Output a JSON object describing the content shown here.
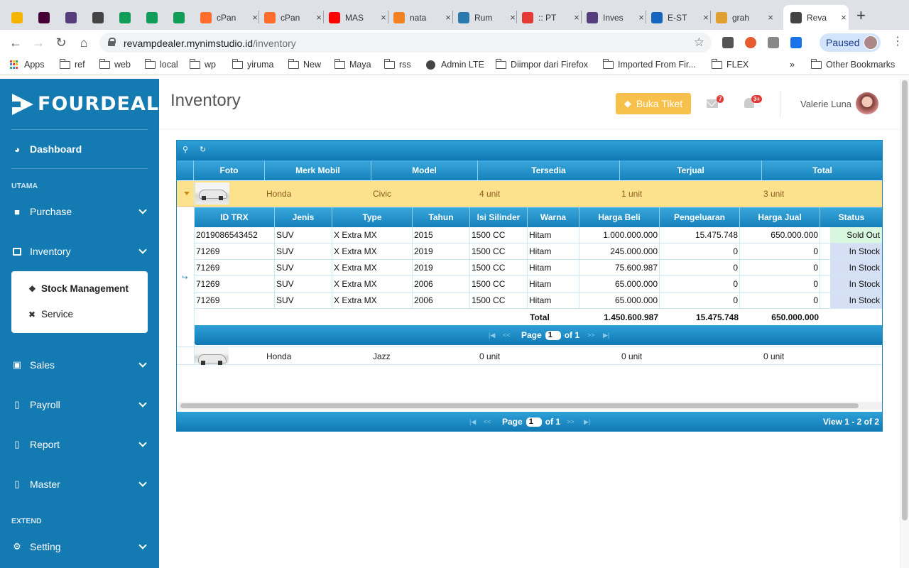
{
  "browser": {
    "tabs": [
      {
        "title": "",
        "favicon": "google-drive-icon",
        "color": "#f4b400"
      },
      {
        "title": "",
        "favicon": "adobe-xd-icon",
        "color": "#470137"
      },
      {
        "title": "",
        "favicon": "bootstrap-icon",
        "color": "#563d7c"
      },
      {
        "title": "",
        "favicon": "globe-icon",
        "color": "#444444"
      },
      {
        "title": "",
        "favicon": "google-sheets-icon",
        "color": "#0f9d58"
      },
      {
        "title": "",
        "favicon": "dollar-icon",
        "color": "#0f9d58"
      },
      {
        "title": "",
        "favicon": "google-sheets-icon",
        "color": "#0f9d58"
      },
      {
        "title": "cPan",
        "favicon": "cpanel-icon",
        "color": "#ff6c2c"
      },
      {
        "title": "cPan",
        "favicon": "cpanel-icon",
        "color": "#ff6c2c"
      },
      {
        "title": "MAS",
        "favicon": "youtube-icon",
        "color": "#ff0000"
      },
      {
        "title": "nata",
        "favicon": "cloudflare-icon",
        "color": "#f48120"
      },
      {
        "title": "Rum",
        "favicon": "house-icon",
        "color": "#2a7ab0"
      },
      {
        "title": ":: PT",
        "favicon": "flame-icon",
        "color": "#e53935"
      },
      {
        "title": "Inves",
        "favicon": "bootstrap-icon",
        "color": "#563d7c"
      },
      {
        "title": "E-ST",
        "favicon": "estore-icon",
        "color": "#1565c0"
      },
      {
        "title": "grah",
        "favicon": "grah-icon",
        "color": "#e0a030"
      },
      {
        "title": "Reva",
        "favicon": "globe-icon",
        "color": "#444444"
      }
    ],
    "url_domain": "revampdealer.mynimstudio.id",
    "url_path": "/inventory",
    "paused_label": "Paused",
    "bookmarks": [
      "Apps",
      "ref",
      "web",
      "local",
      "wp",
      "yiruma",
      "New",
      "Maya",
      "rss",
      "Admin LTE",
      "Diimpor dari Firefox",
      "Imported From Fir...",
      "FLEX"
    ],
    "other_bookmarks": "Other Bookmarks",
    "more": "»"
  },
  "sidebar": {
    "logo": "FOURDEALER",
    "dashboard": "Dashboard",
    "section_utama": "UTAMA",
    "purchase": "Purchase",
    "inventory": "Inventory",
    "stock_management": "Stock Management",
    "service": "Service",
    "sales": "Sales",
    "payroll": "Payroll",
    "report": "Report",
    "master": "Master",
    "section_extend": "EXTEND",
    "setting": "Setting"
  },
  "header": {
    "title": "Inventory",
    "buka_tiket": "Buka Tiket",
    "mail_badge": "7",
    "bell_badge": "3+",
    "user_name": "Valerie Luna"
  },
  "grid": {
    "columns": [
      "Foto",
      "Merk Mobil",
      "Model",
      "Tersedia",
      "Terjual",
      "Total"
    ],
    "rows": [
      {
        "merk": "Honda",
        "model": "Civic",
        "tersedia": "4 unit",
        "terjual": "1 unit",
        "total": "3 unit"
      },
      {
        "merk": "Honda",
        "model": "Jazz",
        "tersedia": "0 unit",
        "terjual": "0 unit",
        "total": "0 unit"
      }
    ],
    "sub_columns": [
      "ID TRX",
      "Jenis",
      "Type",
      "Tahun",
      "Isi Silinder",
      "Warna",
      "Harga Beli",
      "Pengeluaran",
      "Harga Jual",
      "Status"
    ],
    "sub_rows": [
      [
        "2019086543452",
        "SUV",
        "X Extra MX",
        "2015",
        "1500 CC",
        "Hitam",
        "1.000.000.000",
        "15.475.748",
        "650.000.000",
        "Sold Out"
      ],
      [
        "71269",
        "SUV",
        "X Extra MX",
        "2019",
        "1500 CC",
        "Hitam",
        "245.000.000",
        "0",
        "0",
        "In Stock"
      ],
      [
        "71269",
        "SUV",
        "X Extra MX",
        "2019",
        "1500 CC",
        "Hitam",
        "75.600.987",
        "0",
        "0",
        "In Stock"
      ],
      [
        "71269",
        "SUV",
        "X Extra MX",
        "2006",
        "1500 CC",
        "Hitam",
        "65.000.000",
        "0",
        "0",
        "In Stock"
      ],
      [
        "71269",
        "SUV",
        "X Extra MX",
        "2006",
        "1500 CC",
        "Hitam",
        "65.000.000",
        "0",
        "0",
        "In Stock"
      ]
    ],
    "total_label": "Total",
    "total_harga_beli": "1.450.600.987",
    "total_pengeluaran": "15.475.748",
    "total_harga_jual": "650.000.000",
    "page_label": "Page",
    "page_value": "1",
    "of_label": "of 1",
    "view_label": "View 1 - 2 of 2"
  }
}
